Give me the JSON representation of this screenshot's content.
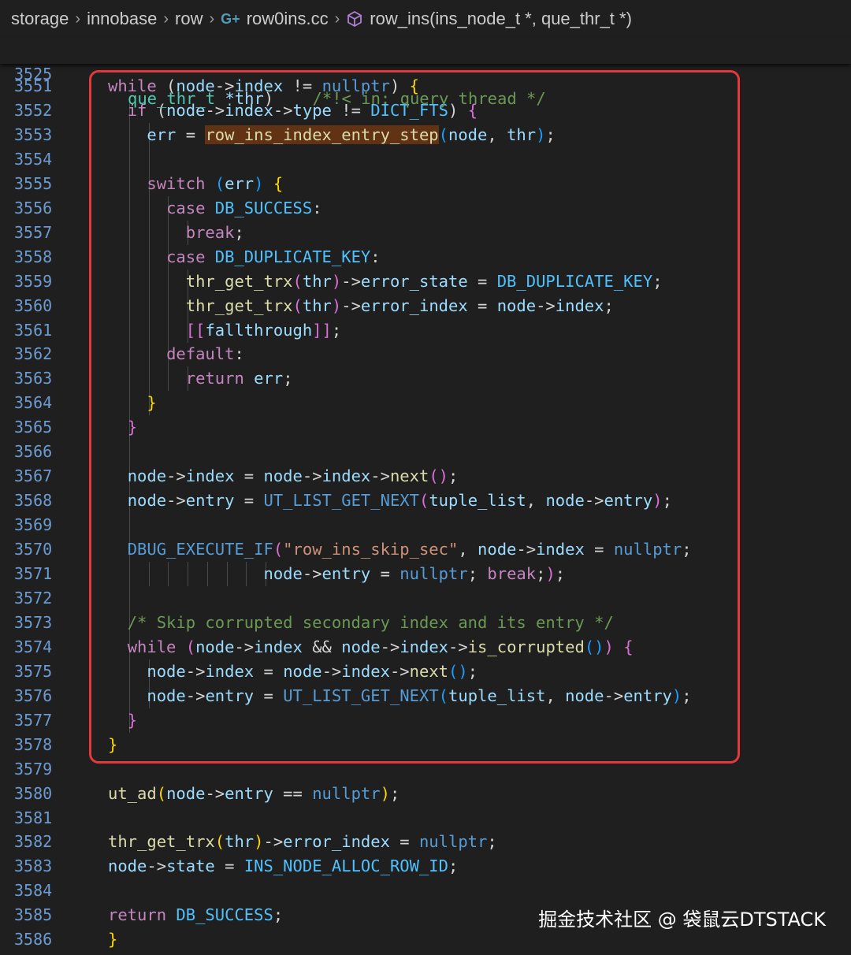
{
  "breadcrumb": {
    "items": [
      "storage",
      "innobase",
      "row",
      "row0ins.cc",
      "row_ins(ins_node_t *, que_thr_t *)"
    ],
    "icons": [
      "chevron-right-icon",
      "cpp-file-icon",
      "method-cube-icon"
    ]
  },
  "sticky_line": {
    "number": "3525",
    "tokens": [
      [
        "que_thr_t",
        "cls"
      ],
      [
        " ",
        "op"
      ],
      [
        "*thr",
        "var"
      ],
      [
        ")",
        "op"
      ],
      [
        "    /*!< in: query thread */",
        "com"
      ]
    ]
  },
  "code_lines": [
    {
      "number": "3551",
      "guides": [],
      "tokens": [
        [
          "while",
          "ctrl"
        ],
        [
          " (",
          "op"
        ],
        [
          "node",
          "var"
        ],
        [
          "->",
          "op"
        ],
        [
          "index",
          "var"
        ],
        [
          " != ",
          "op"
        ],
        [
          "nullptr",
          "kw"
        ],
        [
          ") ",
          "op"
        ],
        [
          "{",
          "p1"
        ]
      ]
    },
    {
      "number": "3552",
      "guides": [
        1
      ],
      "tokens": [
        [
          "  ",
          "op"
        ],
        [
          "if",
          "ctrl"
        ],
        [
          " (",
          "op"
        ],
        [
          "node",
          "var"
        ],
        [
          "->",
          "op"
        ],
        [
          "index",
          "var"
        ],
        [
          "->",
          "op"
        ],
        [
          "type",
          "var"
        ],
        [
          " != ",
          "op"
        ],
        [
          "DICT_FTS",
          "cst"
        ],
        [
          ") ",
          "op"
        ],
        [
          "{",
          "p2"
        ]
      ]
    },
    {
      "number": "3553",
      "guides": [
        1,
        2
      ],
      "tokens": [
        [
          "    ",
          "op"
        ],
        [
          "err",
          "var"
        ],
        [
          " = ",
          "op"
        ],
        [
          "row_ins_index_entry_step",
          "fn",
          "hl"
        ],
        [
          "(",
          "p3"
        ],
        [
          "node",
          "var"
        ],
        [
          ", ",
          "op"
        ],
        [
          "thr",
          "var"
        ],
        [
          ")",
          "p3"
        ],
        [
          ";",
          "op"
        ]
      ]
    },
    {
      "number": "3554",
      "guides": [
        1,
        2
      ],
      "tokens": []
    },
    {
      "number": "3555",
      "guides": [
        1,
        2
      ],
      "tokens": [
        [
          "    ",
          "op"
        ],
        [
          "switch",
          "ctrl"
        ],
        [
          " (",
          "p3"
        ],
        [
          "err",
          "var"
        ],
        [
          ") ",
          "p3"
        ],
        [
          "{",
          "p1"
        ]
      ]
    },
    {
      "number": "3556",
      "guides": [
        1,
        2,
        3
      ],
      "tokens": [
        [
          "      ",
          "op"
        ],
        [
          "case",
          "ctrl"
        ],
        [
          " ",
          "op"
        ],
        [
          "DB_SUCCESS",
          "cst"
        ],
        [
          ":",
          "op"
        ]
      ]
    },
    {
      "number": "3557",
      "guides": [
        1,
        2,
        3,
        4
      ],
      "tokens": [
        [
          "        ",
          "op"
        ],
        [
          "break",
          "ctrl"
        ],
        [
          ";",
          "op"
        ]
      ]
    },
    {
      "number": "3558",
      "guides": [
        1,
        2,
        3
      ],
      "tokens": [
        [
          "      ",
          "op"
        ],
        [
          "case",
          "ctrl"
        ],
        [
          " ",
          "op"
        ],
        [
          "DB_DUPLICATE_KEY",
          "cst"
        ],
        [
          ":",
          "op"
        ]
      ]
    },
    {
      "number": "3559",
      "guides": [
        1,
        2,
        3,
        4
      ],
      "tokens": [
        [
          "        ",
          "op"
        ],
        [
          "thr_get_trx",
          "fn"
        ],
        [
          "(",
          "p2"
        ],
        [
          "thr",
          "var"
        ],
        [
          ")",
          "p2"
        ],
        [
          "->",
          "op"
        ],
        [
          "error_state",
          "var"
        ],
        [
          " = ",
          "op"
        ],
        [
          "DB_DUPLICATE_KEY",
          "cst"
        ],
        [
          ";",
          "op"
        ]
      ]
    },
    {
      "number": "3560",
      "guides": [
        1,
        2,
        3,
        4
      ],
      "tokens": [
        [
          "        ",
          "op"
        ],
        [
          "thr_get_trx",
          "fn"
        ],
        [
          "(",
          "p2"
        ],
        [
          "thr",
          "var"
        ],
        [
          ")",
          "p2"
        ],
        [
          "->",
          "op"
        ],
        [
          "error_index",
          "var"
        ],
        [
          " = ",
          "op"
        ],
        [
          "node",
          "var"
        ],
        [
          "->",
          "op"
        ],
        [
          "index",
          "var"
        ],
        [
          ";",
          "op"
        ]
      ]
    },
    {
      "number": "3561",
      "guides": [
        1,
        2,
        3,
        4
      ],
      "tokens": [
        [
          "        ",
          "op"
        ],
        [
          "[[",
          "p2"
        ],
        [
          "fallthrough",
          "var"
        ],
        [
          "]]",
          "p2"
        ],
        [
          ";",
          "op"
        ]
      ]
    },
    {
      "number": "3562",
      "guides": [
        1,
        2,
        3
      ],
      "tokens": [
        [
          "      ",
          "op"
        ],
        [
          "default",
          "ctrl"
        ],
        [
          ":",
          "op"
        ]
      ]
    },
    {
      "number": "3563",
      "guides": [
        1,
        2,
        3,
        4
      ],
      "tokens": [
        [
          "        ",
          "op"
        ],
        [
          "return",
          "ctrl"
        ],
        [
          " ",
          "op"
        ],
        [
          "err",
          "var"
        ],
        [
          ";",
          "op"
        ]
      ]
    },
    {
      "number": "3564",
      "guides": [
        1,
        2
      ],
      "tokens": [
        [
          "    ",
          "op"
        ],
        [
          "}",
          "p1"
        ]
      ]
    },
    {
      "number": "3565",
      "guides": [
        1
      ],
      "tokens": [
        [
          "  ",
          "op"
        ],
        [
          "}",
          "p2"
        ]
      ]
    },
    {
      "number": "3566",
      "guides": [
        1
      ],
      "tokens": []
    },
    {
      "number": "3567",
      "guides": [
        1
      ],
      "tokens": [
        [
          "  ",
          "op"
        ],
        [
          "node",
          "var"
        ],
        [
          "->",
          "op"
        ],
        [
          "index",
          "var"
        ],
        [
          " = ",
          "op"
        ],
        [
          "node",
          "var"
        ],
        [
          "->",
          "op"
        ],
        [
          "index",
          "var"
        ],
        [
          "->",
          "op"
        ],
        [
          "next",
          "fn"
        ],
        [
          "()",
          "p2"
        ],
        [
          ";",
          "op"
        ]
      ]
    },
    {
      "number": "3568",
      "guides": [
        1
      ],
      "tokens": [
        [
          "  ",
          "op"
        ],
        [
          "node",
          "var"
        ],
        [
          "->",
          "op"
        ],
        [
          "entry",
          "var"
        ],
        [
          " = ",
          "op"
        ],
        [
          "UT_LIST_GET_NEXT",
          "kw"
        ],
        [
          "(",
          "p2"
        ],
        [
          "tuple_list",
          "var"
        ],
        [
          ", ",
          "op"
        ],
        [
          "node",
          "var"
        ],
        [
          "->",
          "op"
        ],
        [
          "entry",
          "var"
        ],
        [
          ")",
          "p2"
        ],
        [
          ";",
          "op"
        ]
      ]
    },
    {
      "number": "3569",
      "guides": [
        1
      ],
      "tokens": []
    },
    {
      "number": "3570",
      "guides": [
        1
      ],
      "tokens": [
        [
          "  ",
          "op"
        ],
        [
          "DBUG_EXECUTE_IF",
          "kw"
        ],
        [
          "(",
          "p2"
        ],
        [
          "\"row_ins_skip_sec\"",
          "str"
        ],
        [
          ", ",
          "op"
        ],
        [
          "node",
          "var"
        ],
        [
          "->",
          "op"
        ],
        [
          "index",
          "var"
        ],
        [
          " = ",
          "op"
        ],
        [
          "nullptr",
          "kw"
        ],
        [
          ";",
          "op"
        ]
      ]
    },
    {
      "number": "3571",
      "guides": [
        1,
        2,
        3,
        4,
        5,
        6,
        7,
        8
      ],
      "tokens": [
        [
          "                ",
          "op"
        ],
        [
          "node",
          "var"
        ],
        [
          "->",
          "op"
        ],
        [
          "entry",
          "var"
        ],
        [
          " = ",
          "op"
        ],
        [
          "nullptr",
          "kw"
        ],
        [
          "; ",
          "op"
        ],
        [
          "break",
          "ctrl"
        ],
        [
          ";",
          "op"
        ],
        [
          ")",
          "p2"
        ],
        [
          ";",
          "op"
        ]
      ]
    },
    {
      "number": "3572",
      "guides": [
        1
      ],
      "tokens": []
    },
    {
      "number": "3573",
      "guides": [
        1
      ],
      "tokens": [
        [
          "  ",
          "op"
        ],
        [
          "/* Skip corrupted secondary index and its entry */",
          "com"
        ]
      ]
    },
    {
      "number": "3574",
      "guides": [
        1
      ],
      "tokens": [
        [
          "  ",
          "op"
        ],
        [
          "while",
          "ctrl"
        ],
        [
          " ",
          "op"
        ],
        [
          "(",
          "p2"
        ],
        [
          "node",
          "var"
        ],
        [
          "->",
          "op"
        ],
        [
          "index",
          "var"
        ],
        [
          " && ",
          "op"
        ],
        [
          "node",
          "var"
        ],
        [
          "->",
          "op"
        ],
        [
          "index",
          "var"
        ],
        [
          "->",
          "op"
        ],
        [
          "is_corrupted",
          "fn"
        ],
        [
          "()",
          "p3"
        ],
        [
          ")",
          "p2"
        ],
        [
          " ",
          "op"
        ],
        [
          "{",
          "p2"
        ]
      ]
    },
    {
      "number": "3575",
      "guides": [
        1,
        2
      ],
      "tokens": [
        [
          "    ",
          "op"
        ],
        [
          "node",
          "var"
        ],
        [
          "->",
          "op"
        ],
        [
          "index",
          "var"
        ],
        [
          " = ",
          "op"
        ],
        [
          "node",
          "var"
        ],
        [
          "->",
          "op"
        ],
        [
          "index",
          "var"
        ],
        [
          "->",
          "op"
        ],
        [
          "next",
          "fn"
        ],
        [
          "()",
          "p3"
        ],
        [
          ";",
          "op"
        ]
      ]
    },
    {
      "number": "3576",
      "guides": [
        1,
        2
      ],
      "tokens": [
        [
          "    ",
          "op"
        ],
        [
          "node",
          "var"
        ],
        [
          "->",
          "op"
        ],
        [
          "entry",
          "var"
        ],
        [
          " = ",
          "op"
        ],
        [
          "UT_LIST_GET_NEXT",
          "kw"
        ],
        [
          "(",
          "p3"
        ],
        [
          "tuple_list",
          "var"
        ],
        [
          ", ",
          "op"
        ],
        [
          "node",
          "var"
        ],
        [
          "->",
          "op"
        ],
        [
          "entry",
          "var"
        ],
        [
          ")",
          "p3"
        ],
        [
          ";",
          "op"
        ]
      ]
    },
    {
      "number": "3577",
      "guides": [
        1
      ],
      "tokens": [
        [
          "  ",
          "op"
        ],
        [
          "}",
          "p2"
        ]
      ]
    },
    {
      "number": "3578",
      "guides": [],
      "tokens": [
        [
          "}",
          "p1"
        ]
      ]
    },
    {
      "number": "3579",
      "guides": [],
      "tokens": []
    },
    {
      "number": "3580",
      "guides": [],
      "tokens": [
        [
          "ut_ad",
          "fn"
        ],
        [
          "(",
          "p1"
        ],
        [
          "node",
          "var"
        ],
        [
          "->",
          "op"
        ],
        [
          "entry",
          "var"
        ],
        [
          " == ",
          "op"
        ],
        [
          "nullptr",
          "kw"
        ],
        [
          ")",
          "p1"
        ],
        [
          ";",
          "op"
        ]
      ]
    },
    {
      "number": "3581",
      "guides": [],
      "tokens": []
    },
    {
      "number": "3582",
      "guides": [],
      "tokens": [
        [
          "thr_get_trx",
          "fn"
        ],
        [
          "(",
          "p1"
        ],
        [
          "thr",
          "var"
        ],
        [
          ")",
          "p1"
        ],
        [
          "->",
          "op"
        ],
        [
          "error_index",
          "var"
        ],
        [
          " = ",
          "op"
        ],
        [
          "nullptr",
          "kw"
        ],
        [
          ";",
          "op"
        ]
      ]
    },
    {
      "number": "3583",
      "guides": [],
      "tokens": [
        [
          "node",
          "var"
        ],
        [
          "->",
          "op"
        ],
        [
          "state",
          "var"
        ],
        [
          " = ",
          "op"
        ],
        [
          "INS_NODE_ALLOC_ROW_ID",
          "cst"
        ],
        [
          ";",
          "op"
        ]
      ]
    },
    {
      "number": "3584",
      "guides": [],
      "tokens": []
    },
    {
      "number": "3585",
      "guides": [],
      "tokens": [
        [
          "return",
          "ctrl"
        ],
        [
          " ",
          "op"
        ],
        [
          "DB_SUCCESS",
          "cst"
        ],
        [
          ";",
          "op"
        ]
      ]
    },
    {
      "number": "3586",
      "guides": [],
      "tokens": [
        [
          "}",
          "p1"
        ]
      ]
    }
  ],
  "watermark": "掘金技术社区 @ 袋鼠云DTSTACK",
  "colors": {
    "background": "#1f1f1f",
    "line_number": "#6b9bd1",
    "highlight_border": "#e5383b",
    "control_keyword": "#c586c0",
    "function": "#dcdcaa",
    "variable": "#9cdcfe",
    "constant": "#4fc1ff",
    "comment": "#6a9955",
    "string": "#ce9178"
  }
}
